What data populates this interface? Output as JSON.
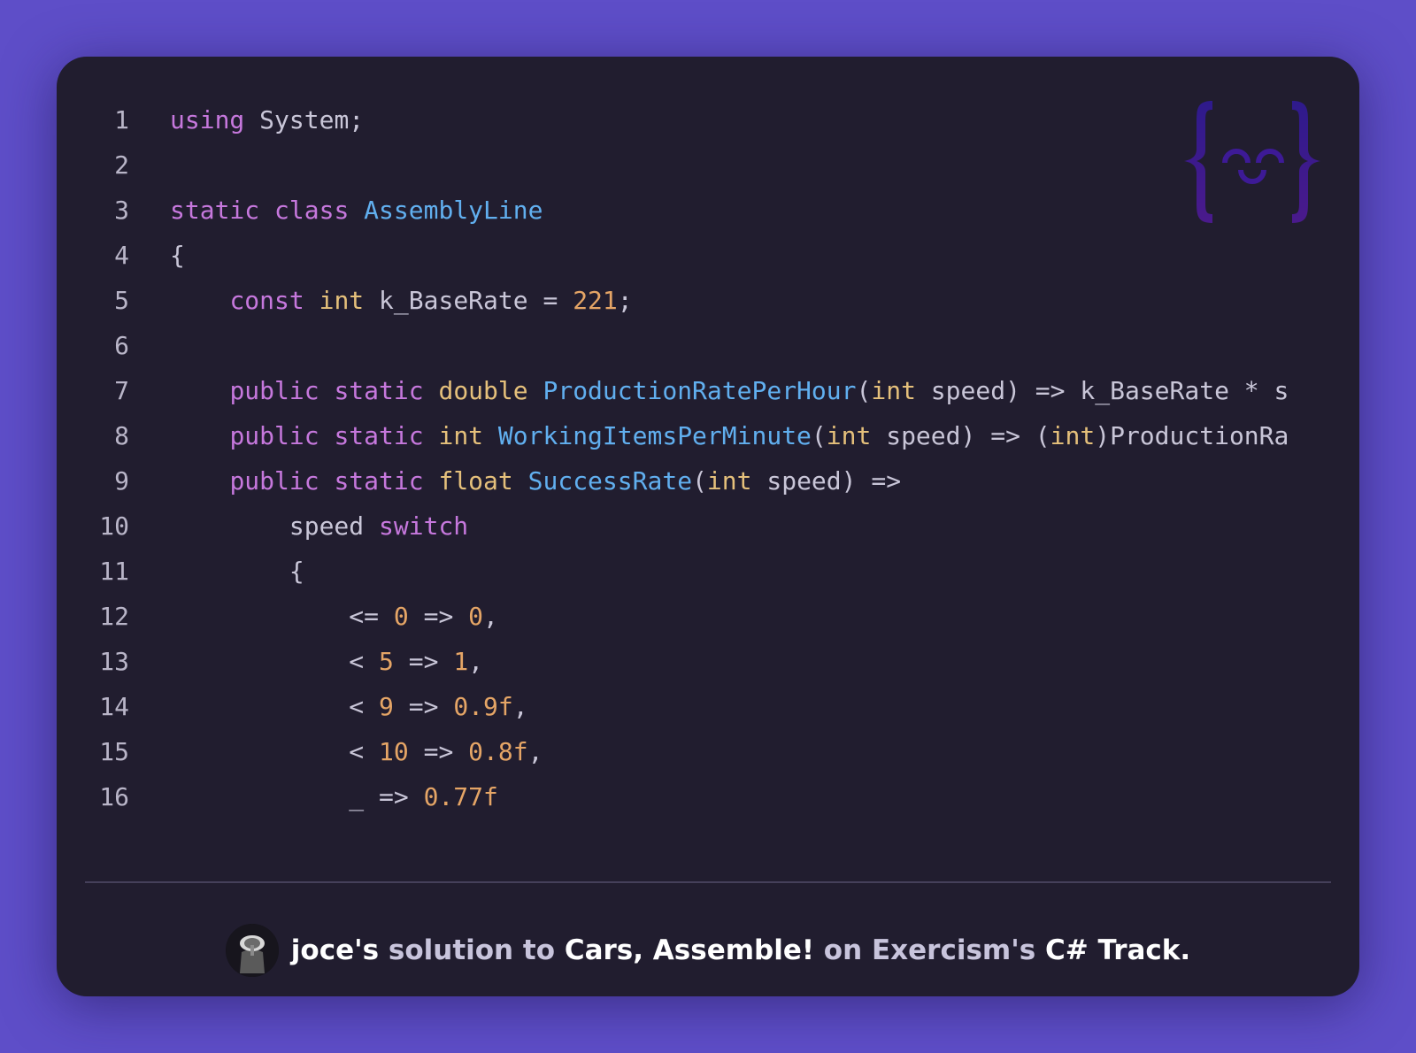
{
  "code": {
    "language": "C#",
    "lines": [
      {
        "n": "1",
        "tokens": [
          {
            "t": "using",
            "c": "kw"
          },
          {
            "t": " System;",
            "c": "pl"
          }
        ]
      },
      {
        "n": "2",
        "tokens": []
      },
      {
        "n": "3",
        "tokens": [
          {
            "t": "static",
            "c": "kw"
          },
          {
            "t": " ",
            "c": "pl"
          },
          {
            "t": "class",
            "c": "kw"
          },
          {
            "t": " ",
            "c": "pl"
          },
          {
            "t": "AssemblyLine",
            "c": "fn"
          }
        ]
      },
      {
        "n": "4",
        "tokens": [
          {
            "t": "{",
            "c": "pl"
          }
        ]
      },
      {
        "n": "5",
        "tokens": [
          {
            "t": "    ",
            "c": "pl"
          },
          {
            "t": "const",
            "c": "kw"
          },
          {
            "t": " ",
            "c": "pl"
          },
          {
            "t": "int",
            "c": "ty"
          },
          {
            "t": " k_BaseRate = ",
            "c": "pl"
          },
          {
            "t": "221",
            "c": "num"
          },
          {
            "t": ";",
            "c": "pl"
          }
        ]
      },
      {
        "n": "6",
        "tokens": []
      },
      {
        "n": "7",
        "tokens": [
          {
            "t": "    ",
            "c": "pl"
          },
          {
            "t": "public",
            "c": "kw"
          },
          {
            "t": " ",
            "c": "pl"
          },
          {
            "t": "static",
            "c": "kw"
          },
          {
            "t": " ",
            "c": "pl"
          },
          {
            "t": "double",
            "c": "ty"
          },
          {
            "t": " ",
            "c": "pl"
          },
          {
            "t": "ProductionRatePerHour",
            "c": "fn"
          },
          {
            "t": "(",
            "c": "pl"
          },
          {
            "t": "int",
            "c": "ty"
          },
          {
            "t": " speed) => k_BaseRate * s",
            "c": "pl"
          }
        ]
      },
      {
        "n": "8",
        "tokens": [
          {
            "t": "    ",
            "c": "pl"
          },
          {
            "t": "public",
            "c": "kw"
          },
          {
            "t": " ",
            "c": "pl"
          },
          {
            "t": "static",
            "c": "kw"
          },
          {
            "t": " ",
            "c": "pl"
          },
          {
            "t": "int",
            "c": "ty"
          },
          {
            "t": " ",
            "c": "pl"
          },
          {
            "t": "WorkingItemsPerMinute",
            "c": "fn"
          },
          {
            "t": "(",
            "c": "pl"
          },
          {
            "t": "int",
            "c": "ty"
          },
          {
            "t": " speed) => (",
            "c": "pl"
          },
          {
            "t": "int",
            "c": "ty"
          },
          {
            "t": ")ProductionRa",
            "c": "pl"
          }
        ]
      },
      {
        "n": "9",
        "tokens": [
          {
            "t": "    ",
            "c": "pl"
          },
          {
            "t": "public",
            "c": "kw"
          },
          {
            "t": " ",
            "c": "pl"
          },
          {
            "t": "static",
            "c": "kw"
          },
          {
            "t": " ",
            "c": "pl"
          },
          {
            "t": "float",
            "c": "ty"
          },
          {
            "t": " ",
            "c": "pl"
          },
          {
            "t": "SuccessRate",
            "c": "fn"
          },
          {
            "t": "(",
            "c": "pl"
          },
          {
            "t": "int",
            "c": "ty"
          },
          {
            "t": " speed) =>",
            "c": "pl"
          }
        ]
      },
      {
        "n": "10",
        "tokens": [
          {
            "t": "        speed ",
            "c": "pl"
          },
          {
            "t": "switch",
            "c": "kw"
          }
        ]
      },
      {
        "n": "11",
        "tokens": [
          {
            "t": "        {",
            "c": "pl"
          }
        ]
      },
      {
        "n": "12",
        "tokens": [
          {
            "t": "            <= ",
            "c": "pl"
          },
          {
            "t": "0",
            "c": "num"
          },
          {
            "t": " => ",
            "c": "pl"
          },
          {
            "t": "0",
            "c": "num"
          },
          {
            "t": ",",
            "c": "pl"
          }
        ]
      },
      {
        "n": "13",
        "tokens": [
          {
            "t": "            < ",
            "c": "pl"
          },
          {
            "t": "5",
            "c": "num"
          },
          {
            "t": " => ",
            "c": "pl"
          },
          {
            "t": "1",
            "c": "num"
          },
          {
            "t": ",",
            "c": "pl"
          }
        ]
      },
      {
        "n": "14",
        "tokens": [
          {
            "t": "            < ",
            "c": "pl"
          },
          {
            "t": "9",
            "c": "num"
          },
          {
            "t": " => ",
            "c": "pl"
          },
          {
            "t": "0.9f",
            "c": "num"
          },
          {
            "t": ",",
            "c": "pl"
          }
        ]
      },
      {
        "n": "15",
        "tokens": [
          {
            "t": "            < ",
            "c": "pl"
          },
          {
            "t": "10",
            "c": "num"
          },
          {
            "t": " => ",
            "c": "pl"
          },
          {
            "t": "0.8f",
            "c": "num"
          },
          {
            "t": ",",
            "c": "pl"
          }
        ]
      },
      {
        "n": "16",
        "tokens": [
          {
            "t": "            _ => ",
            "c": "pl"
          },
          {
            "t": "0.77f",
            "c": "num"
          }
        ]
      }
    ]
  },
  "logo": {
    "icon": "exercism-curly-face-icon"
  },
  "footer": {
    "author": "joce",
    "possessive1": "'s",
    "solution_to": " solution to ",
    "exercise": "Cars, Assemble!",
    "on": " on ",
    "site": "Exercism",
    "possessive2": "'s",
    "track": "C# Track."
  },
  "colors": {
    "background": "#5e4ec8",
    "card": "#211d2f",
    "keyword": "#c678dd",
    "type": "#e5c07b",
    "function": "#61afef",
    "number": "#e5a566"
  }
}
